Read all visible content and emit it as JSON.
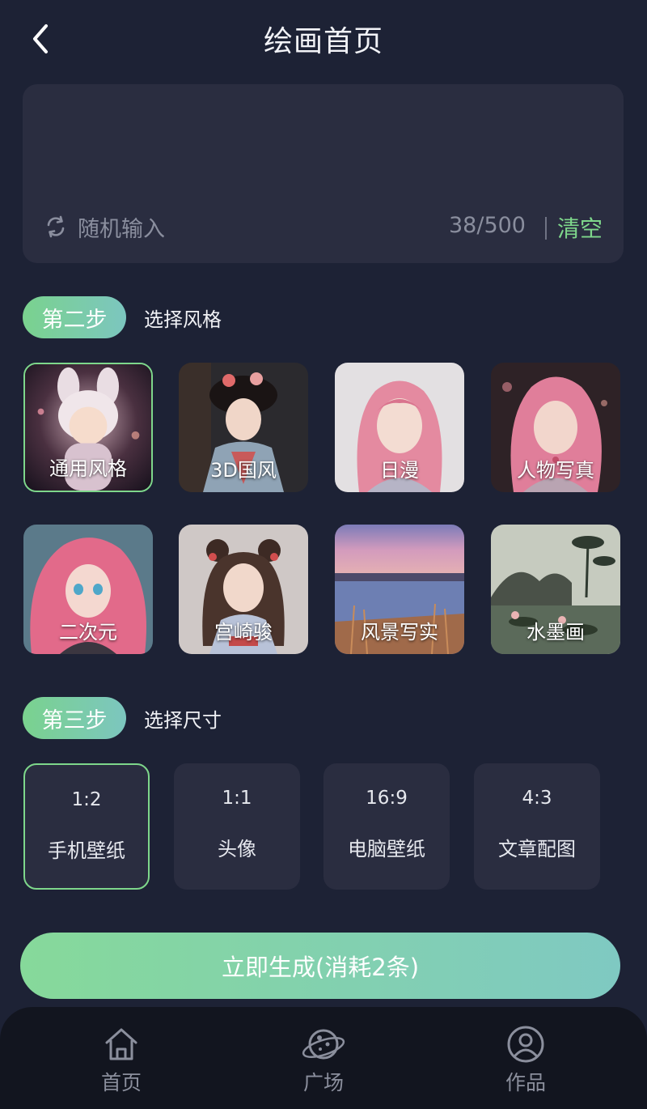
{
  "header": {
    "title": "绘画首页",
    "back_icon": "chevron-left-icon"
  },
  "prompt": {
    "text": "",
    "random_label": "随机输入",
    "counter": "38/500",
    "clear_label": "清空"
  },
  "step2": {
    "badge": "第二步",
    "label": "选择风格",
    "styles": [
      {
        "name": "通用风格",
        "selected": true
      },
      {
        "name": "3D国风",
        "selected": false
      },
      {
        "name": "日漫",
        "selected": false
      },
      {
        "name": "人物写真",
        "selected": false
      },
      {
        "name": "二次元",
        "selected": false
      },
      {
        "name": "宫崎骏",
        "selected": false
      },
      {
        "name": "风景写实",
        "selected": false
      },
      {
        "name": "水墨画",
        "selected": false
      }
    ]
  },
  "step3": {
    "badge": "第三步",
    "label": "选择尺寸",
    "sizes": [
      {
        "ratio": "1:2",
        "name": "手机壁纸",
        "selected": true
      },
      {
        "ratio": "1:1",
        "name": "头像",
        "selected": false
      },
      {
        "ratio": "16:9",
        "name": "电脑壁纸",
        "selected": false
      },
      {
        "ratio": "4:3",
        "name": "文章配图",
        "selected": false
      }
    ]
  },
  "generate": {
    "label": "立即生成(消耗2条)"
  },
  "nav": {
    "items": [
      {
        "label": "首页",
        "icon": "home-icon"
      },
      {
        "label": "广场",
        "icon": "planet-icon"
      },
      {
        "label": "作品",
        "icon": "user-icon"
      }
    ]
  },
  "colors": {
    "background": "#1d2235",
    "card": "#2a2d40",
    "accent_green": "#7ed78b",
    "accent_teal": "#7cc6bf"
  }
}
